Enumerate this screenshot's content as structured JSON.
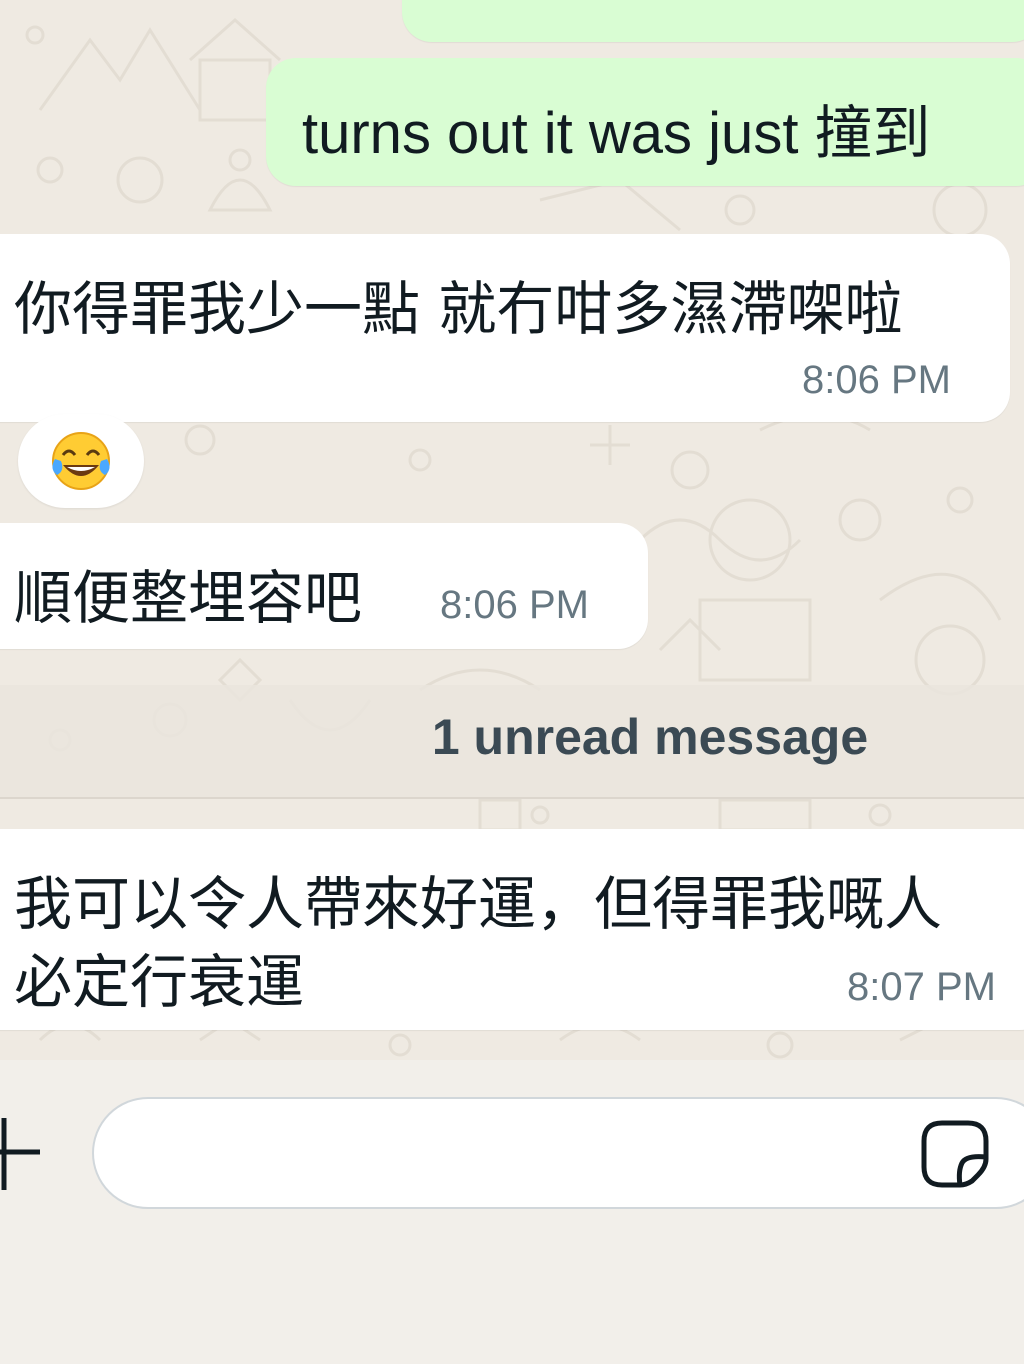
{
  "chat": {
    "messages": [
      {
        "direction": "outgoing",
        "text": "turns out it was just 撞到"
      },
      {
        "direction": "incoming",
        "text": "你得罪我少一點 就冇咁多濕滯㗎啦",
        "time": "8:06 PM",
        "reaction": "😂"
      },
      {
        "direction": "incoming",
        "text": "順便整埋容吧",
        "time": "8:06 PM"
      },
      {
        "direction": "incoming",
        "text_lines": [
          "我可以令人帶來好運，但得罪我嘅人",
          "必定行衰運"
        ],
        "time": "8:07 PM"
      }
    ],
    "unread_divider": "1 unread message"
  },
  "composer": {
    "input_value": "",
    "attach_icon": "plus-icon",
    "sticker_icon": "sticker-icon"
  },
  "colors": {
    "outgoing_bubble": "#d9fdd3",
    "incoming_bubble": "#ffffff",
    "wallpaper": "#efeae2",
    "timestamp": "#667781"
  }
}
